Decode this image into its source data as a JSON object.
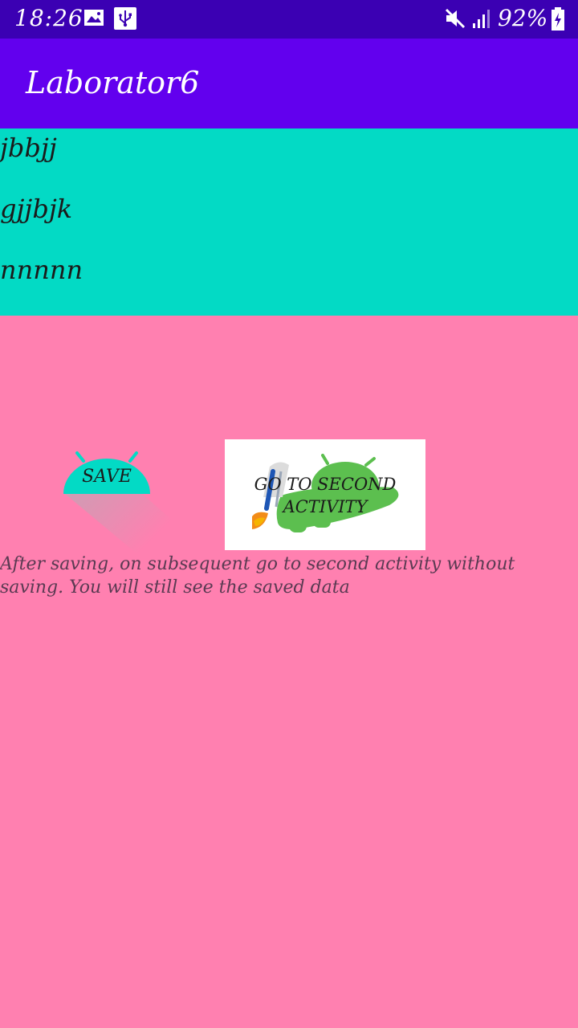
{
  "status_bar": {
    "time": "18:26",
    "battery_percent": "92%",
    "icons": [
      "image-icon",
      "usb-icon",
      "mute-icon",
      "signal-icon",
      "battery-charging-icon"
    ],
    "background": "#3b00b3"
  },
  "app_bar": {
    "title": "Laborator6",
    "background": "#6200ee"
  },
  "list": {
    "background": "#03dac5",
    "items": [
      "jbbjj",
      "gjjbjk",
      "nnnnn"
    ]
  },
  "buttons": {
    "save_label": "SAVE",
    "save_color": "#03dac5",
    "second_activity_label_line1": "GO TO SECOND",
    "second_activity_label_line2": "ACTIVITY"
  },
  "hint": {
    "text": "After saving, on subsequent go to second activity without saving. You will still see the saved data"
  },
  "colors": {
    "page_background": "#ff80b0",
    "android_green": "#5cbf4f"
  }
}
